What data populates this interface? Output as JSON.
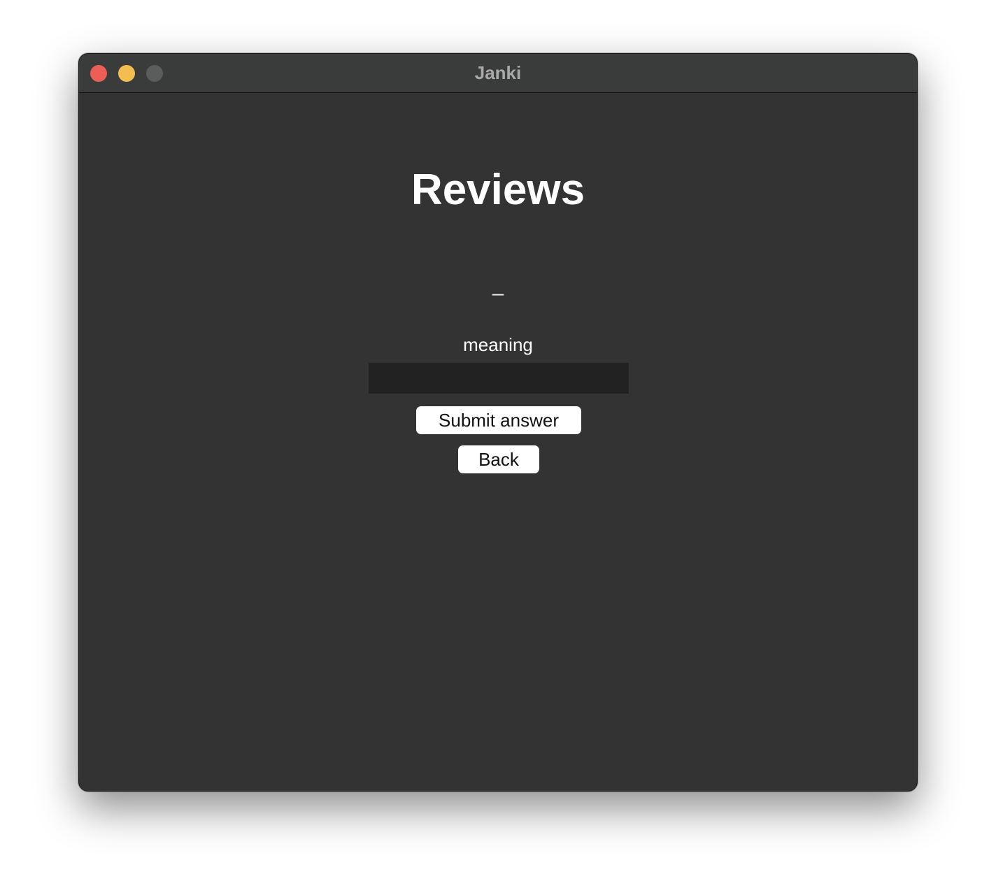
{
  "window": {
    "title": "Janki"
  },
  "main": {
    "heading": "Reviews",
    "prompt": "_",
    "field_label": "meaning",
    "answer_input": {
      "value": "",
      "placeholder": ""
    },
    "buttons": {
      "submit_label": "Submit answer",
      "back_label": "Back"
    }
  },
  "colors": {
    "close": "#ec5f56",
    "minimize": "#f4bd4f",
    "zoom_disabled": "#5b5c5c",
    "window_bg": "#333333",
    "input_bg": "#222222",
    "button_bg": "#ffffff"
  },
  "icons": {
    "close": "close-icon",
    "minimize": "minimize-icon",
    "zoom": "zoom-icon"
  }
}
